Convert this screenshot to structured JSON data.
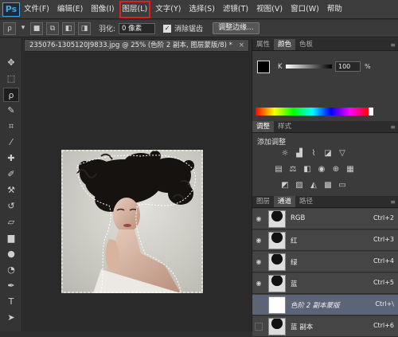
{
  "app": {
    "logo": "Ps"
  },
  "menu": {
    "items": [
      {
        "label": "文件(F)",
        "name": "menu-file"
      },
      {
        "label": "编辑(E)",
        "name": "menu-edit"
      },
      {
        "label": "图像(I)",
        "name": "menu-image"
      },
      {
        "label": "图层(L)",
        "name": "menu-layer",
        "highlight": true
      },
      {
        "label": "文字(Y)",
        "name": "menu-type"
      },
      {
        "label": "选择(S)",
        "name": "menu-select"
      },
      {
        "label": "滤镜(T)",
        "name": "menu-filter"
      },
      {
        "label": "视图(V)",
        "name": "menu-view"
      },
      {
        "label": "窗口(W)",
        "name": "menu-window"
      },
      {
        "label": "帮助",
        "name": "menu-help"
      }
    ]
  },
  "options": {
    "feather_label": "羽化:",
    "feather_value": "0 像素",
    "antialias_label": "消除锯齿",
    "refine_edge_label": "调整边缘..."
  },
  "document": {
    "tab_title": "235076-1305120J9833.jpg @ 25% (色阶 2 副本, 图层蒙版/8) *",
    "close_glyph": "×"
  },
  "panels": {
    "color_tabs": [
      "属性",
      "颜色",
      "色板"
    ],
    "color_active": 1,
    "k_label": "K",
    "k_value": "100",
    "k_unit": "%",
    "adjust_tabs": [
      "调整",
      "样式"
    ],
    "adjust_active": 0,
    "adjust_title": "添加调整",
    "channels_tabs": [
      "图层",
      "通道",
      "路径"
    ],
    "channels_active": 1,
    "channels": [
      {
        "name": "RGB",
        "key": "Ctrl+2",
        "eye": true,
        "selected": false
      },
      {
        "name": "红",
        "key": "Ctrl+3",
        "eye": true,
        "selected": false
      },
      {
        "name": "绿",
        "key": "Ctrl+4",
        "eye": true,
        "selected": false
      },
      {
        "name": "蓝",
        "key": "Ctrl+5",
        "eye": true,
        "selected": false
      },
      {
        "name": "色阶 2 副本蒙版",
        "key": "Ctrl+\\",
        "eye": false,
        "selected": true
      },
      {
        "name": "蓝 副本",
        "key": "Ctrl+6",
        "eye": false,
        "selected": false
      }
    ]
  },
  "colors": {
    "highlight_red": "#e02020",
    "selected_row": "#5c6478",
    "accent_blue": "#4aa3df"
  }
}
